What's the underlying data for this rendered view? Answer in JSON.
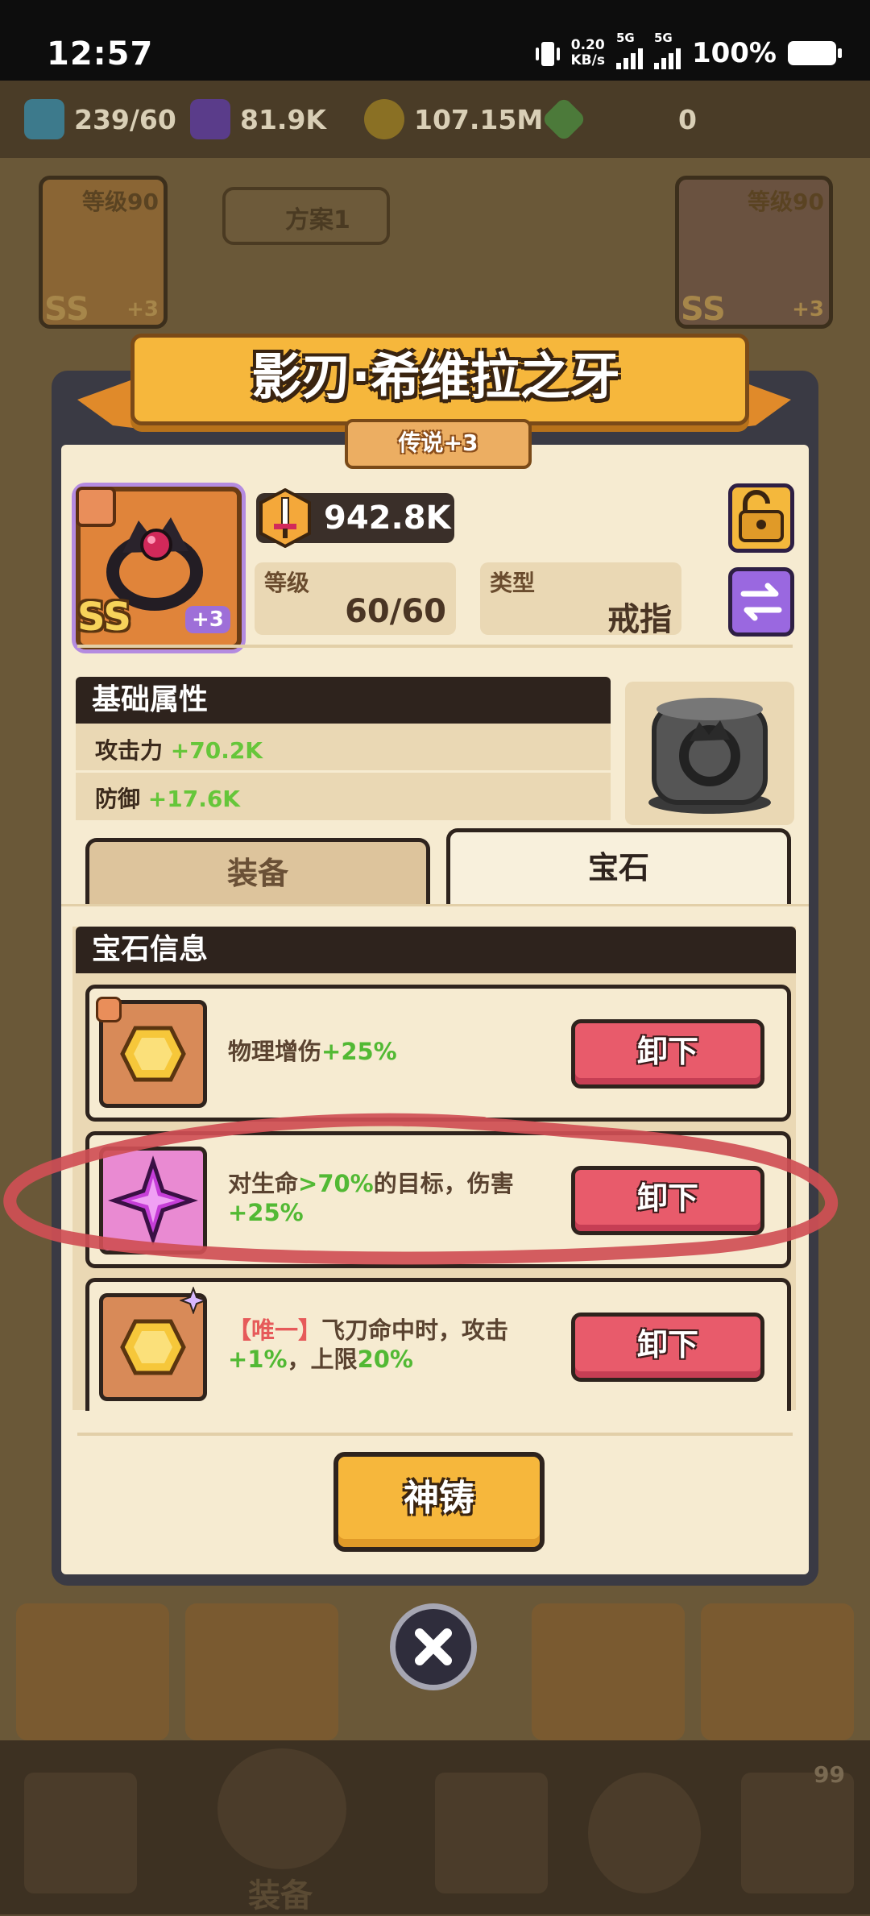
{
  "status_bar": {
    "time": "12:57",
    "net_speed_value": "0.20",
    "net_speed_unit": "KB/s",
    "sim1": "5G",
    "sim2": "5G",
    "battery": "100%"
  },
  "resources": [
    {
      "icon": "energy-icon",
      "value": "239/60"
    },
    {
      "icon": "purple-cube-icon",
      "value": "81.9K"
    },
    {
      "icon": "gold-coin-icon",
      "value": "107.15M"
    },
    {
      "icon": "green-gem-icon",
      "value": "0"
    }
  ],
  "background": {
    "left_card_level": "等级90",
    "right_card_level": "等级90",
    "plan_button": "方案1",
    "card_grade": "SS",
    "card_plus": "+3",
    "nav_label": "装备",
    "nav_badge": "99"
  },
  "dialog": {
    "title": "影刃·希维拉之牙",
    "rarity": "传说+3",
    "item": {
      "grade": "SS",
      "enhance": "+3",
      "power": "942.8K",
      "level_label": "等级",
      "level_value": "60/60",
      "type_label": "类型",
      "type_value": "戒指"
    },
    "base_attrs": {
      "header": "基础属性",
      "rows": [
        {
          "label": "攻击力",
          "value": "+70.2K"
        },
        {
          "label": "防御",
          "value": "+17.6K"
        }
      ]
    },
    "tabs": [
      {
        "label": "装备",
        "active": false
      },
      {
        "label": "宝石",
        "active": true
      }
    ],
    "gems": {
      "header": "宝石信息",
      "items": [
        {
          "slot_color": "#d88a58",
          "gem": "yellow-gem-icon",
          "text_pre": "物理增伤",
          "text_green": "+25%",
          "text_mid": "",
          "text_green2": "",
          "text_post": "",
          "unique": "",
          "button": "卸下"
        },
        {
          "slot_color": "#e98ad2",
          "gem": "pink-star-gem-icon",
          "text_pre": "对生命",
          "text_green": ">70%",
          "text_mid": "的目标，伤害",
          "text_green2": "+25%",
          "text_post": "",
          "unique": "",
          "button": "卸下"
        },
        {
          "slot_color": "#d88a58",
          "gem": "yellow-gem-icon",
          "text_pre": "飞刀命中时，攻击",
          "text_green": "+1%",
          "text_mid": "，上限",
          "text_green2": "20%",
          "text_post": "",
          "unique": "【唯一】",
          "button": "卸下"
        }
      ]
    },
    "forge_button": "神铸"
  },
  "colors": {
    "dialog_bg": "#f6ebd1",
    "title_banner": "#f6b73c",
    "unequip_button": "#e85b6b",
    "positive_stat": "#52b934",
    "header_dark": "#2e231d",
    "annotation_stroke": "#cf4f55"
  }
}
